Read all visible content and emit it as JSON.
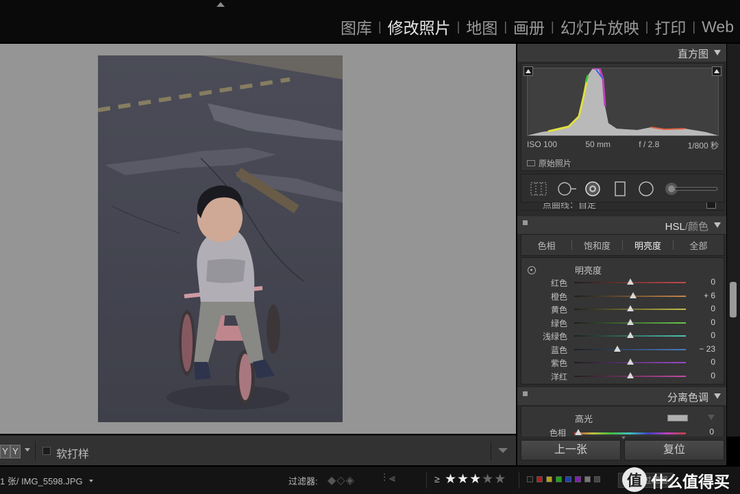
{
  "modules": [
    "图库",
    "修改照片",
    "地图",
    "画册",
    "幻灯片放映",
    "打印",
    "Web"
  ],
  "active_module": "修改照片",
  "module_separator": "|",
  "photo": {
    "description": "child riding a pink balance bike on asphalt road"
  },
  "toolbar": {
    "view_buttons": [
      "Y",
      "Y"
    ],
    "softproof_label": "软打样"
  },
  "histogram": {
    "title": "直方图",
    "exif": [
      "ISO 100",
      "50 mm",
      "f / 2.8",
      "1/800 秒"
    ],
    "original_photo_label": "原始照片"
  },
  "tone_curve_cutoff": "点曲线：自定",
  "hsl": {
    "title": "HSL",
    "title_sep": "/",
    "title_alt": "颜色",
    "tabs": [
      "色相",
      "饱和度",
      "明亮度",
      "全部"
    ],
    "active_tab": "明亮度",
    "section_title": "明亮度",
    "sliders": [
      {
        "label": "红色",
        "value": "0",
        "level": 0,
        "color": "#c84a4a"
      },
      {
        "label": "橙色",
        "value": "+ 6",
        "level": 6,
        "color": "#c8874a"
      },
      {
        "label": "黄色",
        "value": "0",
        "level": 0,
        "color": "#c8c04a"
      },
      {
        "label": "绿色",
        "value": "0",
        "level": 0,
        "color": "#6ac84a"
      },
      {
        "label": "浅绿色",
        "value": "0",
        "level": 0,
        "color": "#4ac8b0"
      },
      {
        "label": "蓝色",
        "value": "− 23",
        "level": -23,
        "color": "#4a7ac8"
      },
      {
        "label": "紫色",
        "value": "0",
        "level": 0,
        "color": "#9a4ac8"
      },
      {
        "label": "洋红",
        "value": "0",
        "level": 0,
        "color": "#c84aa8"
      }
    ]
  },
  "split_toning": {
    "title": "分离色调",
    "section_title": "高光",
    "hue_label": "色相",
    "hue_value": "0"
  },
  "buttons": {
    "previous": "上一张",
    "reset": "复位"
  },
  "filmstrip": {
    "info": "1 张/ IMG_5598.JPG",
    "filter_label": "过滤器:",
    "flag_icons": "◆◇◈",
    "adjust_icons": "⫶⫷",
    "rating_operator": "≥",
    "rating": 3,
    "rating_max": 5,
    "color_labels": [
      "#1a1a1a",
      "#b02020",
      "#b0a020",
      "#20a020",
      "#2040b0",
      "#8020b0",
      "#777777",
      "#444444"
    ],
    "filter_button": "过滤器"
  },
  "watermark": {
    "badge": "值",
    "text": "什么值得买"
  }
}
